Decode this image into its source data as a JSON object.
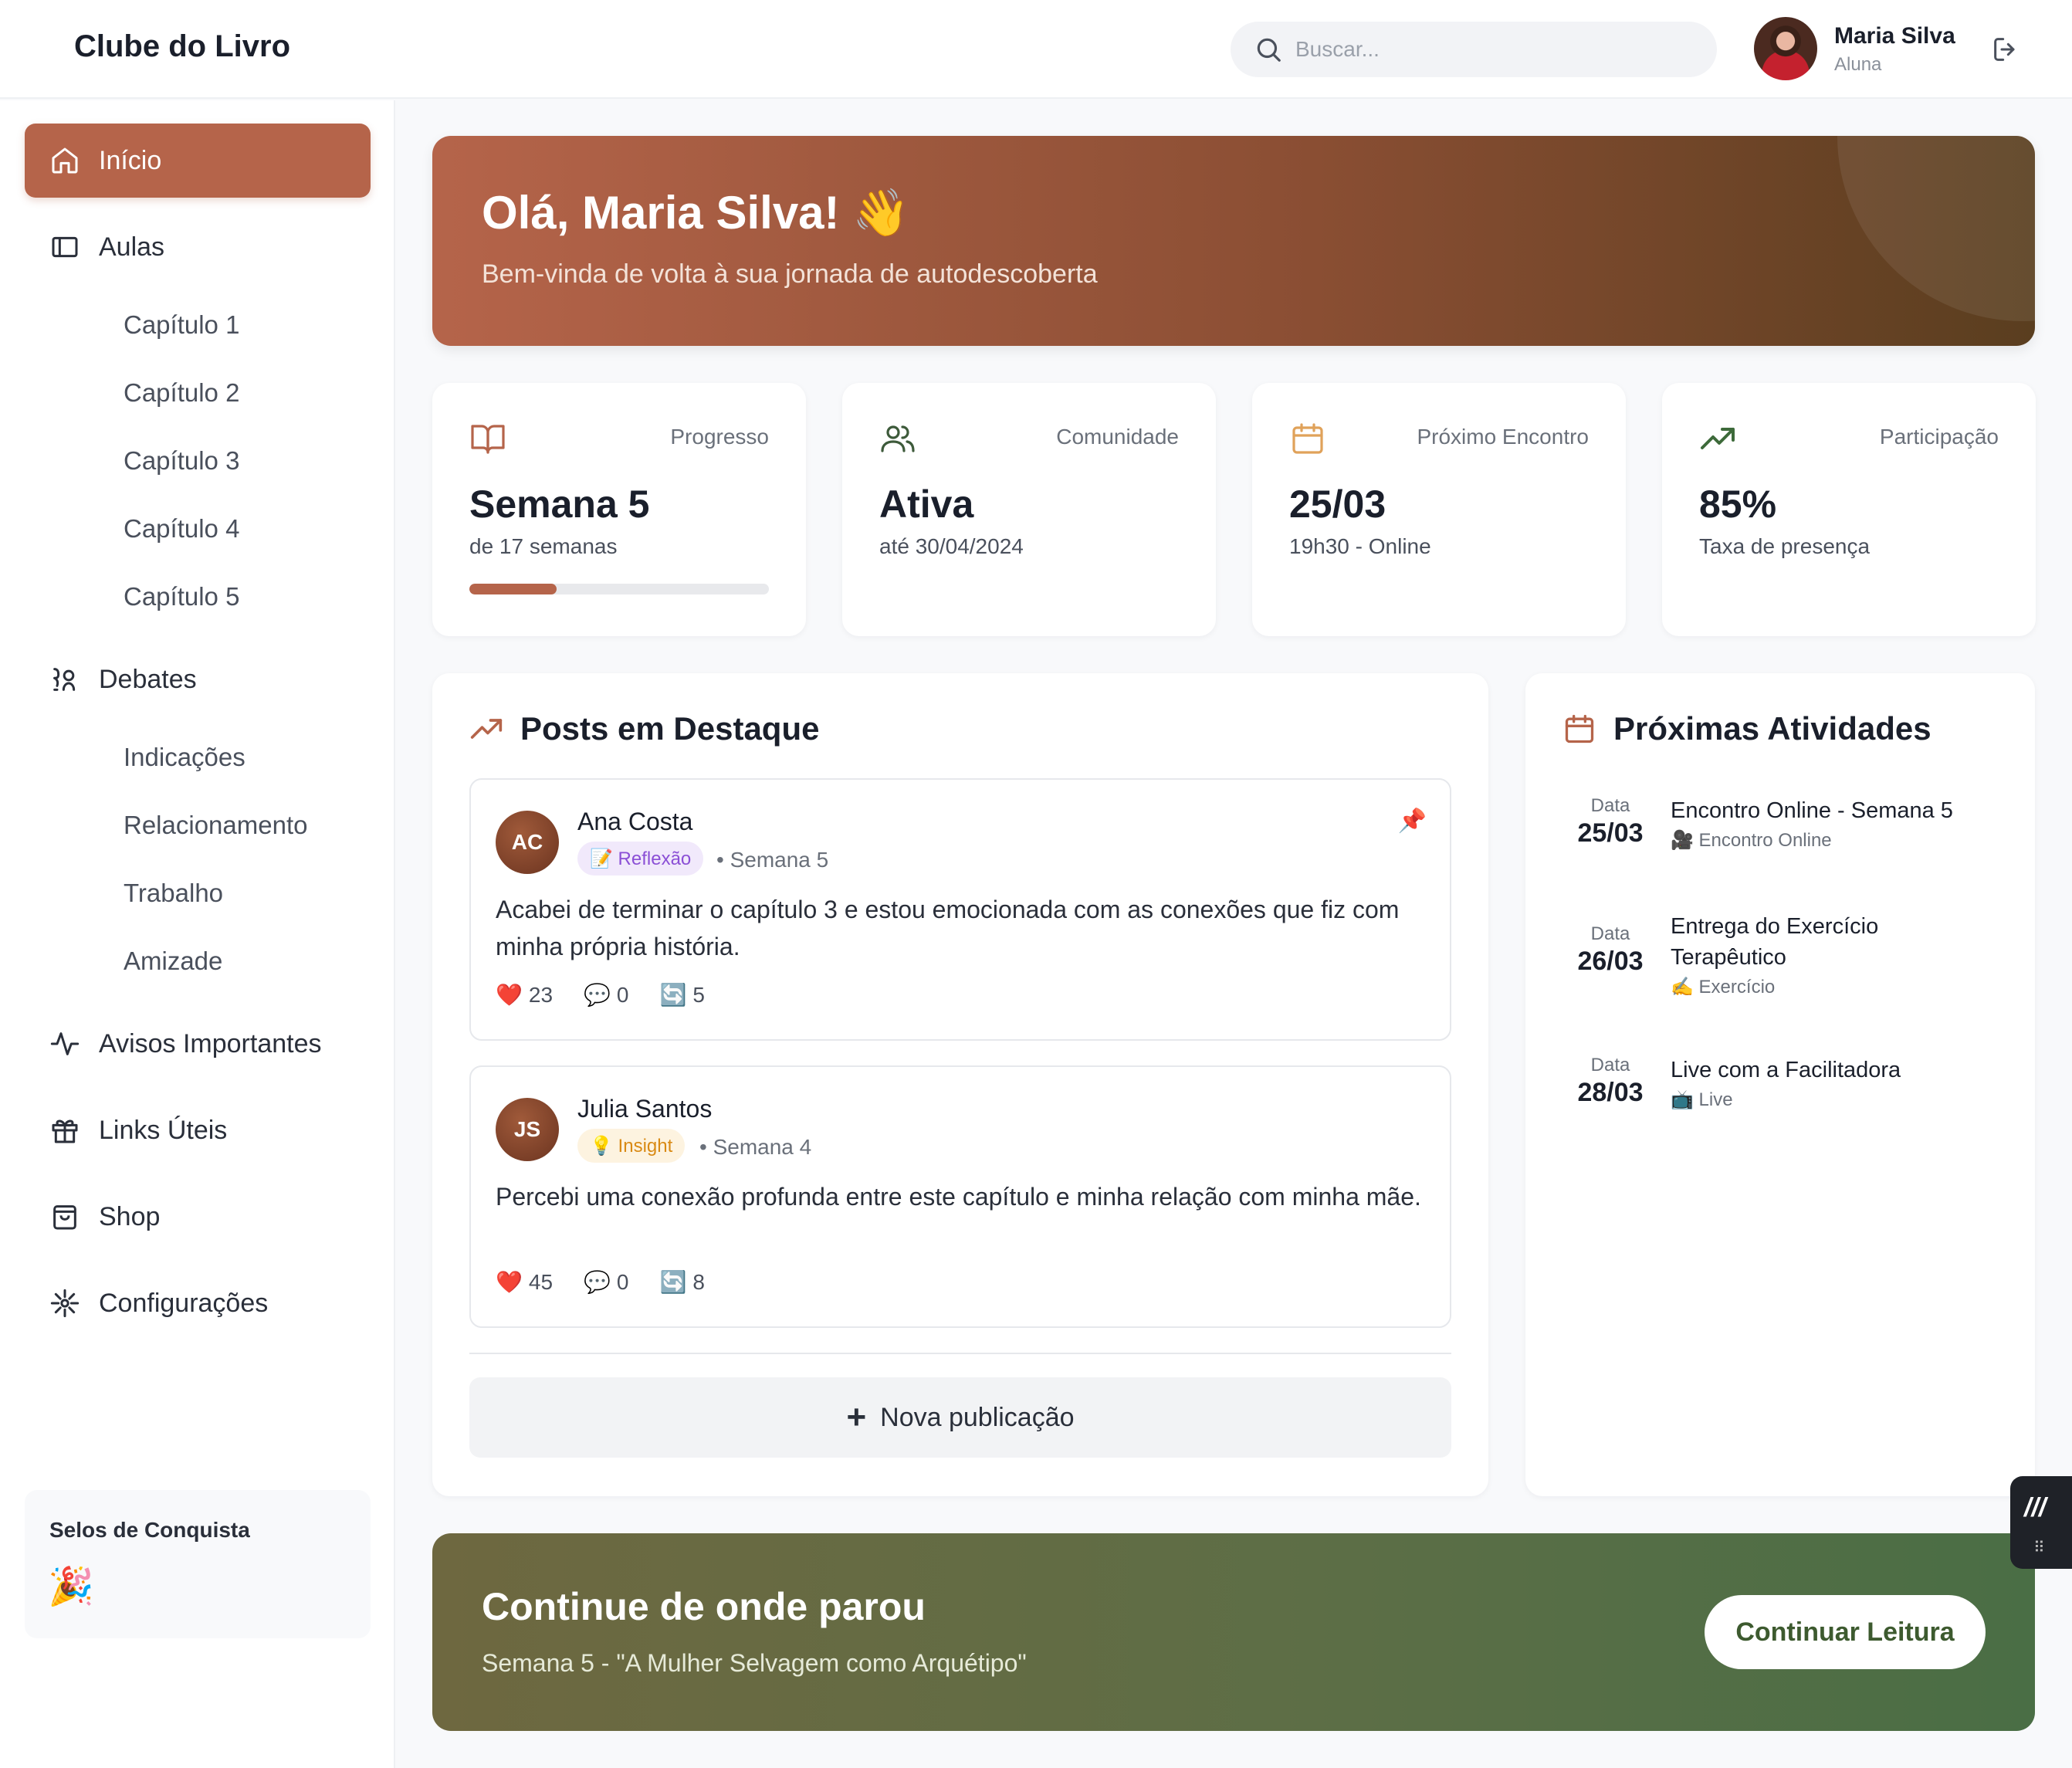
{
  "header": {
    "brand": "Clube do Livro",
    "search_placeholder": "Buscar...",
    "user_name": "Maria Silva",
    "user_role": "Aluna"
  },
  "sidebar": {
    "items": [
      {
        "label": "Início",
        "icon": "home-icon",
        "active": true
      },
      {
        "label": "Aulas",
        "icon": "panel-icon"
      },
      {
        "label": "Debates",
        "icon": "people-icon"
      },
      {
        "label": "Avisos Importantes",
        "icon": "activity-icon"
      },
      {
        "label": "Links Úteis",
        "icon": "gift-icon"
      },
      {
        "label": "Shop",
        "icon": "shopping-bag-icon"
      },
      {
        "label": "Configurações",
        "icon": "settings-icon"
      }
    ],
    "aulas_sub": [
      "Capítulo 1",
      "Capítulo 2",
      "Capítulo 3",
      "Capítulo 4",
      "Capítulo 5"
    ],
    "debates_sub": [
      "Indicações",
      "Relacionamento",
      "Trabalho",
      "Amizade"
    ],
    "badges_title": "Selos de Conquista",
    "badges_icon": "🎉"
  },
  "hero": {
    "title": "Olá, Maria Silva! 👋",
    "subtitle": "Bem-vinda de volta à sua jornada de autodescoberta"
  },
  "stats": [
    {
      "label": "Progresso",
      "value": "Semana 5",
      "desc": "de 17 semanas",
      "icon": "book-open-icon",
      "progress": 0.29
    },
    {
      "label": "Comunidade",
      "value": "Ativa",
      "desc": "até 30/04/2024",
      "icon": "users-icon"
    },
    {
      "label": "Próximo Encontro",
      "value": "25/03",
      "desc": "19h30 - Online",
      "icon": "calendar-icon"
    },
    {
      "label": "Participação",
      "value": "85%",
      "desc": "Taxa de presença",
      "icon": "trending-up-icon"
    }
  ],
  "posts_section": {
    "title": "Posts em Destaque",
    "posts": [
      {
        "initials": "AC",
        "author": "Ana Costa",
        "tag": "📝 Reflexão",
        "week": "• Semana 5",
        "pinned_icon": "📌",
        "text": "Acabei de terminar o capítulo 3 e estou emocionada com as conexões que fiz com minha própria história.",
        "likes_icon": "❤️",
        "likes": "23",
        "comments_icon": "💬",
        "comments": "0",
        "shares_icon": "🔄",
        "shares": "5"
      },
      {
        "initials": "JS",
        "author": "Julia Santos",
        "tag": "💡 Insight",
        "week": "• Semana 4",
        "text": "Percebi uma conexão profunda entre este capítulo e minha relação com minha mãe.",
        "likes_icon": "❤️",
        "likes": "45",
        "comments_icon": "💬",
        "comments": "0",
        "shares_icon": "🔄",
        "shares": "8"
      }
    ],
    "new_post_label": "Nova publicação"
  },
  "activities": {
    "title": "Próximas Atividades",
    "items": [
      {
        "date_label": "Data",
        "date": "25/03",
        "title": "Encontro Online - Semana 5",
        "type": "🎥 Encontro Online"
      },
      {
        "date_label": "Data",
        "date": "26/03",
        "title": "Entrega do Exercício Terapêutico",
        "type": "✍️ Exercício"
      },
      {
        "date_label": "Data",
        "date": "28/03",
        "title": "Live com a Facilitadora",
        "type": "📺 Live"
      }
    ]
  },
  "cta": {
    "title": "Continue de onde parou",
    "subtitle": "Semana 5 - \"A Mulher Selvagem como Arquétipo\"",
    "button": "Continuar Leitura"
  },
  "colors": {
    "accent": "#b5644a",
    "cta_green": "#4a6e45",
    "tag_purple_bg": "#f1e9fb",
    "tag_purple_fg": "#8b4fd6",
    "tag_yellow_bg": "#fdf3e0",
    "tag_yellow_fg": "#d98a14"
  }
}
